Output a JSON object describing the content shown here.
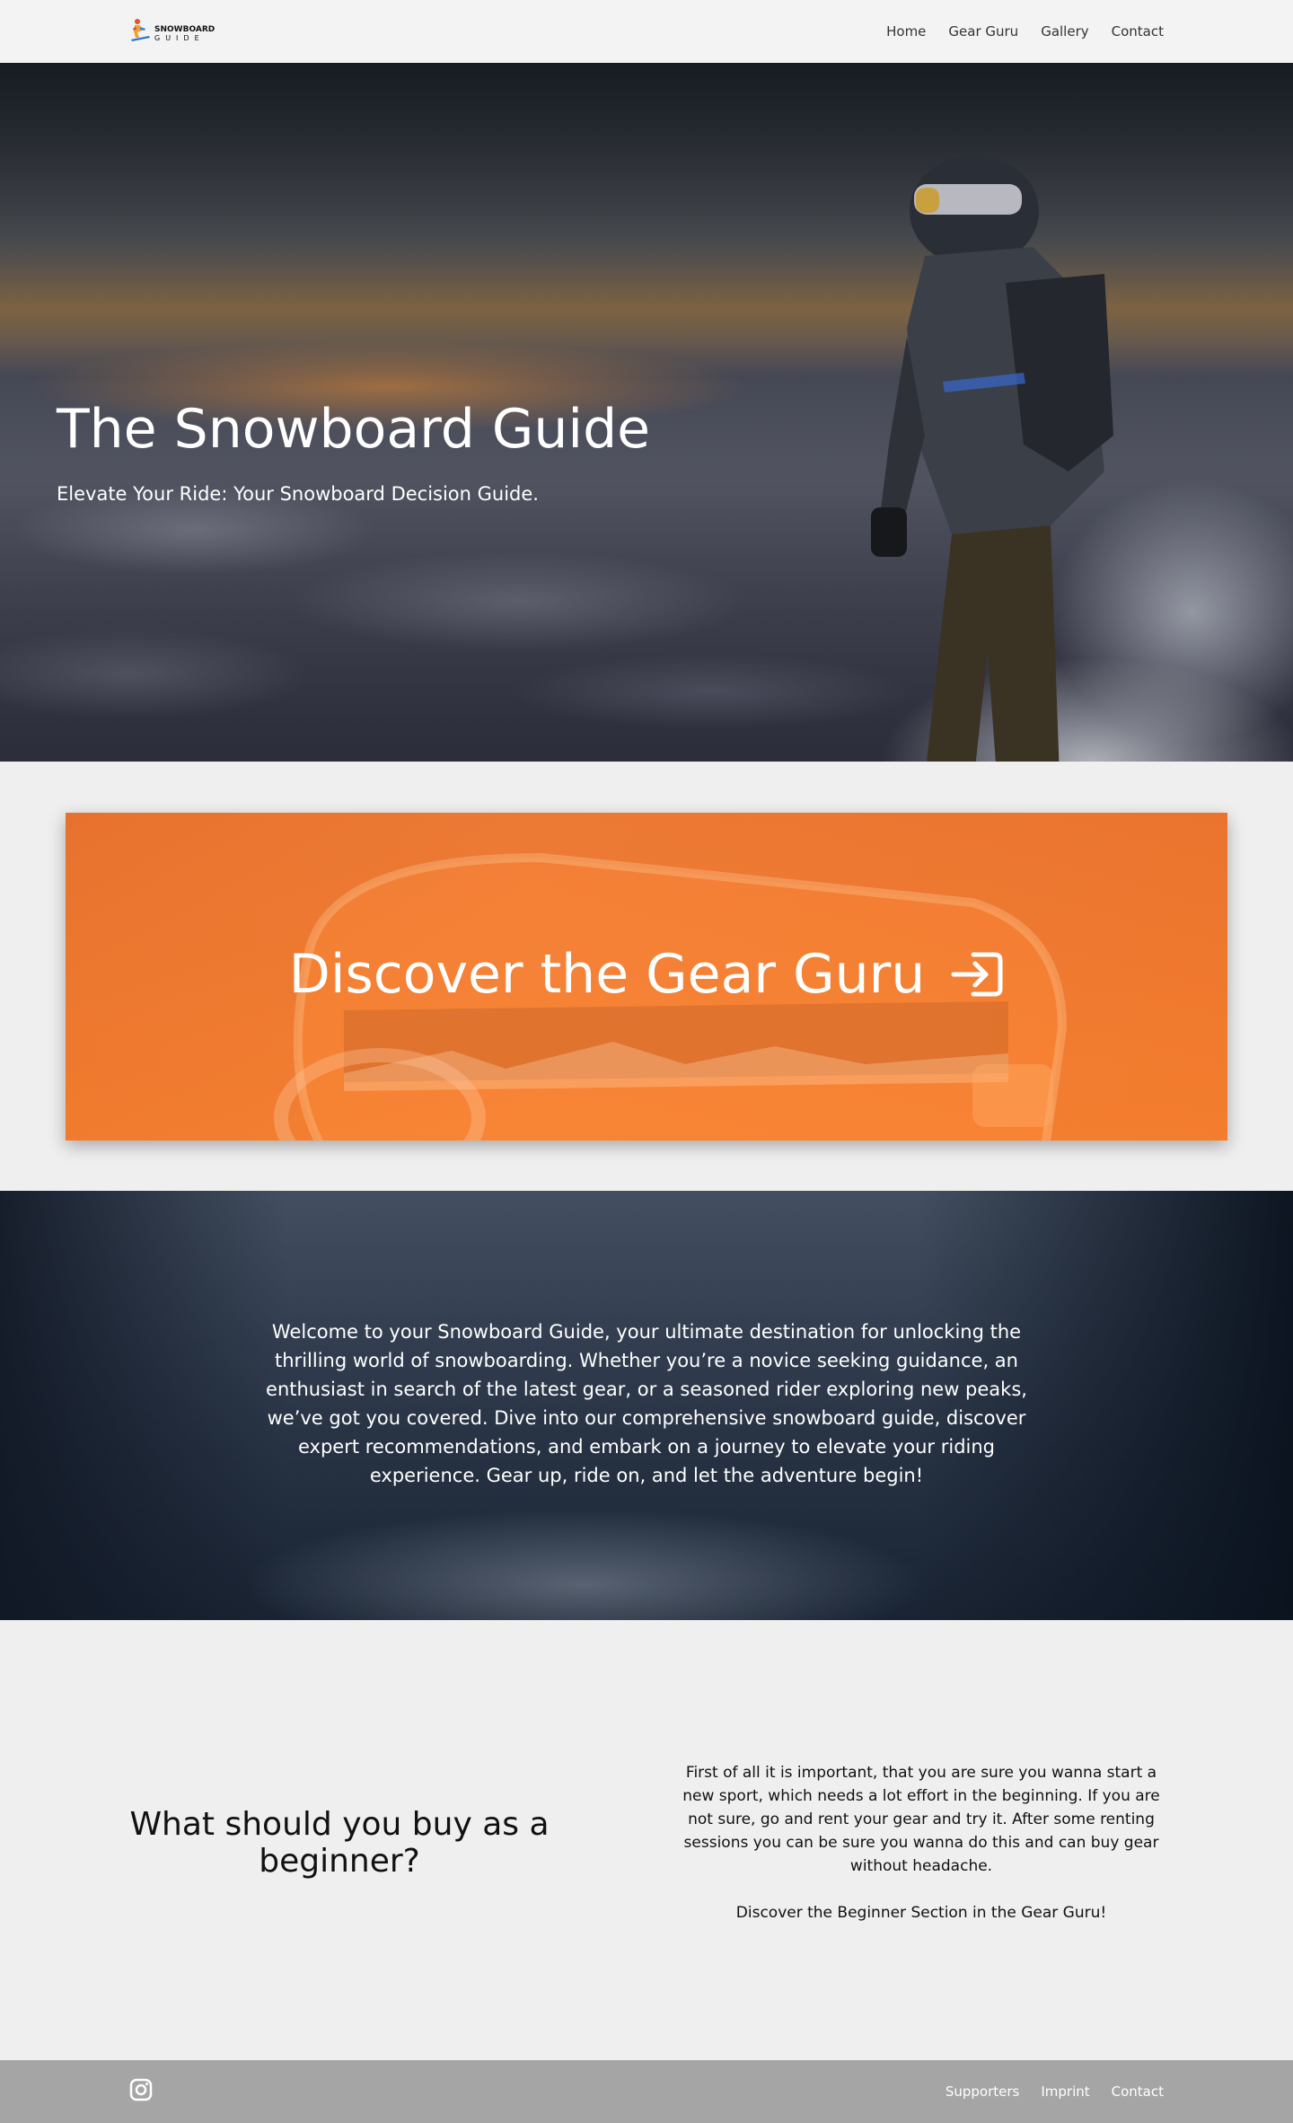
{
  "header": {
    "logo_top": "SNOWBOARD",
    "logo_bottom": "GUIDE",
    "nav": [
      {
        "label": "Home"
      },
      {
        "label": "Gear Guru"
      },
      {
        "label": "Gallery"
      },
      {
        "label": "Contact"
      }
    ]
  },
  "hero": {
    "title": "The Snowboard Guide",
    "subtitle": "Elevate Your Ride: Your Snowboard Decision Guide."
  },
  "cta": {
    "label": "Discover the Gear Guru",
    "icon": "login-arrow-icon",
    "color": "#eb732d"
  },
  "welcome": {
    "text": "Welcome to your Snowboard Guide, your ultimate destination for unlocking the thrilling world of snowboarding. Whether you’re a novice seeking guidance, an enthusiast in search of the latest gear, or a seasoned rider exploring new peaks, we’ve got you covered. Dive into our comprehensive snowboard guide, discover expert recommendations, and embark on a journey to elevate your riding experience. Gear up, ride on, and let the adventure begin!"
  },
  "beginner": {
    "heading": "What should you buy as a beginner?",
    "paragraph1": "First of all it is important, that you are sure you wanna start a new sport, which needs a lot effort in the beginning. If you are not sure, go and rent your gear and try it. After some renting sessions you can be sure you wanna do this and can buy gear without headache.",
    "paragraph2": "Discover the Beginner Section in the Gear Guru!"
  },
  "footer": {
    "social_icon": "instagram-icon",
    "links": [
      {
        "label": "Supporters"
      },
      {
        "label": "Imprint"
      },
      {
        "label": "Contact"
      }
    ]
  }
}
